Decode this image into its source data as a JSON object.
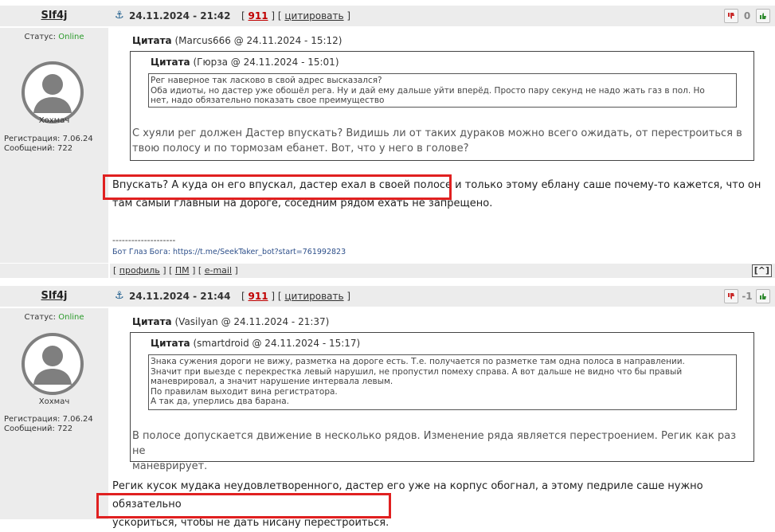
{
  "posts": [
    {
      "author": "Slf4j",
      "datetime": "24.11.2024 - 21:42",
      "post_number": "911",
      "cite_label": "цитировать",
      "score": "0",
      "status_label": "Статус:",
      "status_value": "Online",
      "nickname": "Хохмач",
      "reg_line": "Регистрация: 7.06.24",
      "msgs_line": "Сообщений: 722",
      "outer_quote_title": "Цитата",
      "outer_quote_meta": "(Marcus666 @ 24.11.2024 - 15:12)",
      "inner_quote_title": "Цитата",
      "inner_quote_meta": "(Гюрза @ 24.11.2024 - 15:01)",
      "inner_quote_lines": [
        "Рег наверное так ласково в свой адрес высказался?",
        "Оба идиоты, но дастер уже обошёл рега. Ну и дай ему дальше уйти вперёд. Просто пару секунд не надо жать газ в пол. Но",
        "нет,  надо обязательно показать свое преимущество"
      ],
      "outer_quote_lines": [
        "С хуяли рег должен Дастер впускать? Видишь ли от таких дураков можно всего ожидать, от перестроиться в",
        "твою полосу и по тормозам ебанет. Вот, что у него в голове?"
      ],
      "text_lines": [
        "Впускать? А куда он его впускал, дастер ехал в своей полосе и только этому еблану саше почему-то кажется, что он",
        "там самый главный на дороге, соседним рядом ехать не запрещено."
      ],
      "sig_line": "--------------------",
      "sig_link": "Бот Глаз Бога: https://t.me/SeekTaker_bot?start=761992823",
      "footer_profile": "профиль",
      "footer_pm": "ПМ",
      "footer_email": "e-mail",
      "footer_up": "[^]"
    },
    {
      "author": "Slf4j",
      "datetime": "24.11.2024 - 21:44",
      "post_number": "911",
      "cite_label": "цитировать",
      "score": "-1",
      "status_label": "Статус:",
      "status_value": "Online",
      "nickname": "Хохмач",
      "reg_line": "Регистрация: 7.06.24",
      "msgs_line": "Сообщений: 722",
      "outer_quote_title": "Цитата",
      "outer_quote_meta": "(Vasilyan @ 24.11.2024 - 21:37)",
      "inner_quote_title": "Цитата",
      "inner_quote_meta": "(smartdroid @ 24.11.2024 - 15:17)",
      "inner_quote_lines": [
        "Знака сужения дороги не вижу, разметка на дороге есть. Т.е. получается по разметке там одна полоса в направлении.",
        "Значит при выезде с перекрестка левый нарушил, не пропустил помеху справа. А вот дальше не видно что бы правый",
        "маневрировал, а значит нарушение интервала левым.",
        "По правилам выходит вина регистратора.",
        "А так да, уперлись два барана."
      ],
      "outer_quote_lines": [
        "В полосе допускается движение в несколько рядов. Изменение ряда является перестроением. Регик как раз не",
        "маневрирует."
      ],
      "text_lines": [
        "Регик кусок мудака неудовлетворенного, дастер его уже на корпус обогнал, а этому педриле саше нужно обязательно",
        "ускориться, чтобы не дать нисану перестроиться."
      ]
    }
  ],
  "colors": {
    "header_bg": "#ececec",
    "online": "#2a9a2a",
    "post_number": "#c00000",
    "highlight_box": "#e02020",
    "sig_link": "#2d4f8a"
  },
  "icons": {
    "anchor": "anchor-icon",
    "vote_down": "thumbs-down-icon",
    "vote_up": "thumbs-up-icon",
    "avatar": "default-avatar-icon"
  }
}
